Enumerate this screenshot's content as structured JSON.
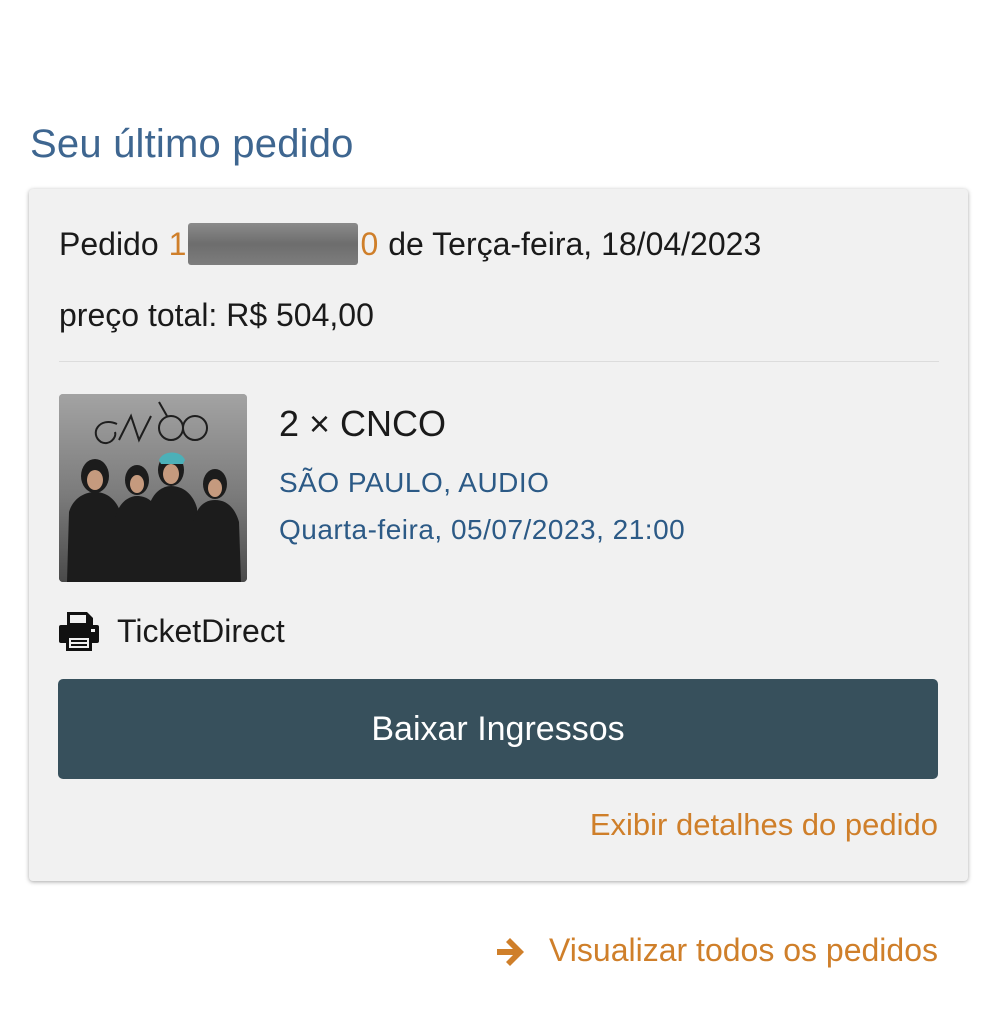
{
  "section": {
    "title": "Seu último pedido"
  },
  "order": {
    "prefix": "Pedido",
    "number_start": "1",
    "number_end": "0",
    "date_text": "de Terça-feira, 18/04/2023",
    "total_text": "preço total: R$ 504,00"
  },
  "item": {
    "image_icon": "cnco-band-photo",
    "image_logo_text": "CNCO",
    "title": "2 × CNCO",
    "venue": "SÃO PAULO, AUDIO",
    "datetime": "Quarta-feira, 05/07/2023, 21:00"
  },
  "delivery": {
    "icon": "printer-icon",
    "label": "TicketDirect"
  },
  "actions": {
    "download_label": "Baixar Ingressos",
    "details_label": "Exibir detalhes do pedido",
    "all_orders_label": "Visualizar todos os pedidos",
    "all_orders_icon": "arrow-right-icon"
  },
  "colors": {
    "title_blue": "#3e6690",
    "link_orange": "#cf7f2a",
    "button_bg": "#37505c",
    "card_bg": "#f1f1f1",
    "meta_blue": "#2c5a86"
  }
}
